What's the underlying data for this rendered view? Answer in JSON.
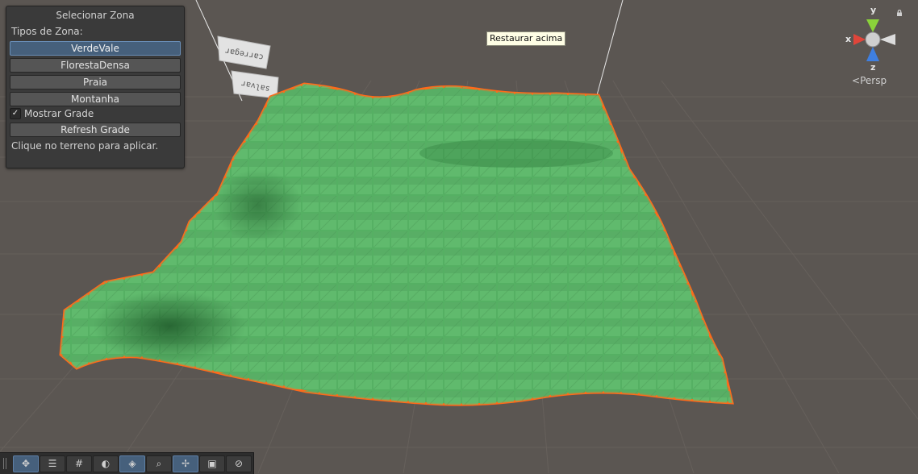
{
  "panel": {
    "title": "Selecionar Zona",
    "zone_types_label": "Tipos de Zona:",
    "zones": [
      {
        "label": "VerdeVale",
        "selected": true
      },
      {
        "label": "FlorestaDensa",
        "selected": false
      },
      {
        "label": "Praia",
        "selected": false
      },
      {
        "label": "Montanha",
        "selected": false
      }
    ],
    "show_grid_label": "Mostrar Grade",
    "show_grid_checked": true,
    "refresh_label": "Refresh Grade",
    "hint": "Clique no terreno para aplicar."
  },
  "scene": {
    "sign_load": "carregar",
    "sign_save": "salvar",
    "terrain_color": "#55b063",
    "outline_color": "#ff6a1a",
    "background_color": "#5b5652"
  },
  "tooltip": {
    "text": "Restaurar acima"
  },
  "gizmo": {
    "y_label": "y",
    "x_label": "x",
    "z_label": "z",
    "projection": "Persp",
    "colors": {
      "y": "#8ad23a",
      "x": "#e0453a",
      "z": "#3f7fe0"
    }
  },
  "toolbar": {
    "tools": [
      {
        "name": "move-tool",
        "icon": "✥",
        "active": true
      },
      {
        "name": "align-tool",
        "icon": "☰",
        "active": false
      },
      {
        "name": "grid-tool",
        "icon": "#",
        "active": false
      },
      {
        "name": "lighting-tool",
        "icon": "◐",
        "active": false
      },
      {
        "name": "layers-tool",
        "icon": "◈",
        "active": true
      },
      {
        "name": "search-tool",
        "icon": "⌕",
        "active": false
      },
      {
        "name": "pivot-tool",
        "icon": "✢",
        "active": true
      },
      {
        "name": "camera-tool",
        "icon": "▣",
        "active": false
      },
      {
        "name": "navigate-tool",
        "icon": "⊘",
        "active": false
      }
    ]
  }
}
